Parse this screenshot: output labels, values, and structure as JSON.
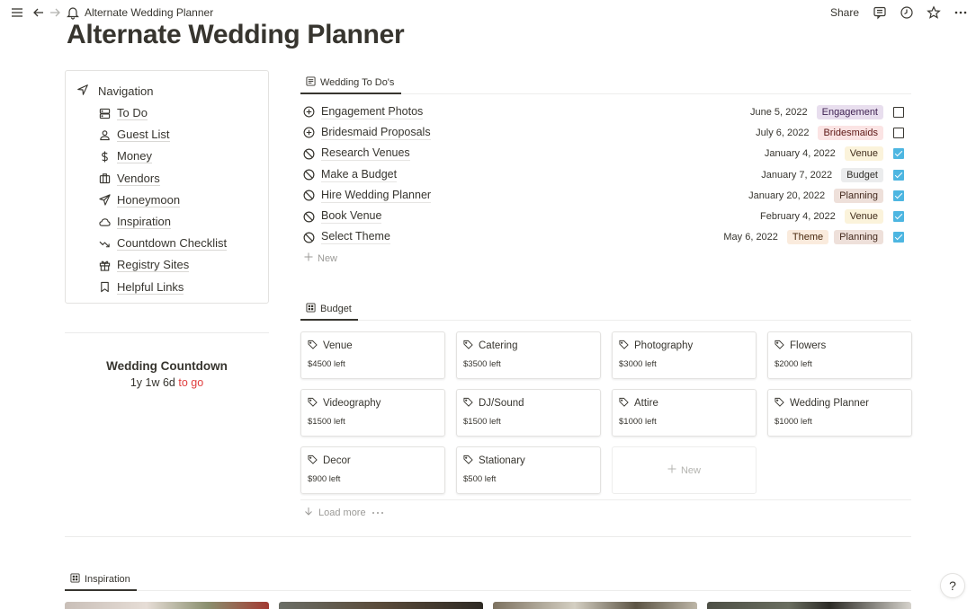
{
  "topbar": {
    "breadcrumb": "Alternate Wedding Planner",
    "share_label": "Share"
  },
  "page": {
    "title": "Alternate Wedding Planner"
  },
  "navigation": {
    "heading": "Navigation",
    "items": [
      {
        "label": "To Do",
        "icon": "database-icon"
      },
      {
        "label": "Guest List",
        "icon": "person-icon"
      },
      {
        "label": "Money",
        "icon": "dollar-icon"
      },
      {
        "label": "Vendors",
        "icon": "briefcase-icon"
      },
      {
        "label": "Honeymoon",
        "icon": "paper-plane-icon"
      },
      {
        "label": "Inspiration",
        "icon": "cloud-icon"
      },
      {
        "label": "Countdown Checklist",
        "icon": "trend-down-icon"
      },
      {
        "label": "Registry Sites",
        "icon": "gift-icon"
      },
      {
        "label": "Helpful Links",
        "icon": "bookmark-icon"
      }
    ]
  },
  "countdown": {
    "title": "Wedding Countdown",
    "value": "1y 1w 6d",
    "suffix": "to go"
  },
  "todos": {
    "tab_label": "Wedding To Do's",
    "new_label": "New",
    "rows": [
      {
        "name": "Engagement Photos",
        "status": "plus",
        "date": "June 5, 2022",
        "tags": [
          "Engagement"
        ],
        "done": false
      },
      {
        "name": "Bridesmaid Proposals",
        "status": "plus",
        "date": "July 6, 2022",
        "tags": [
          "Bridesmaids"
        ],
        "done": false
      },
      {
        "name": "Research Venues",
        "status": "blocked",
        "date": "January 4, 2022",
        "tags": [
          "Venue"
        ],
        "done": true
      },
      {
        "name": "Make a Budget",
        "status": "blocked",
        "date": "January 7, 2022",
        "tags": [
          "Budget"
        ],
        "done": true
      },
      {
        "name": "Hire Wedding Planner",
        "status": "blocked",
        "date": "January 20, 2022",
        "tags": [
          "Planning"
        ],
        "done": true
      },
      {
        "name": "Book Venue",
        "status": "blocked",
        "date": "February 4, 2022",
        "tags": [
          "Venue"
        ],
        "done": true
      },
      {
        "name": "Select Theme",
        "status": "blocked",
        "date": "May 6, 2022",
        "tags": [
          "Theme",
          "Planning"
        ],
        "done": true
      }
    ]
  },
  "tag_colors": {
    "Engagement": {
      "bg": "#e8deee",
      "fg": "#412454"
    },
    "Bridesmaids": {
      "bg": "#fbe4e4",
      "fg": "#5d1715"
    },
    "Venue": {
      "bg": "#fbf3db",
      "fg": "#402c1b"
    },
    "Budget": {
      "bg": "#ebeced",
      "fg": "#32302c"
    },
    "Planning": {
      "bg": "#eee0da",
      "fg": "#442a1e"
    },
    "Theme": {
      "bg": "#faebdd",
      "fg": "#49290e"
    }
  },
  "budget": {
    "tab_label": "Budget",
    "new_label": "New",
    "load_more_label": "Load more",
    "cards": [
      {
        "name": "Venue",
        "left": "$4500 left"
      },
      {
        "name": "Catering",
        "left": "$3500 left"
      },
      {
        "name": "Photography",
        "left": "$3000 left"
      },
      {
        "name": "Flowers",
        "left": "$2000 left"
      },
      {
        "name": "Videography",
        "left": "$1500 left"
      },
      {
        "name": "DJ/Sound",
        "left": "$1500 left"
      },
      {
        "name": "Attire",
        "left": "$1000 left"
      },
      {
        "name": "Wedding Planner",
        "left": "$1000 left"
      },
      {
        "name": "Decor",
        "left": "$900 left"
      },
      {
        "name": "Stationary",
        "left": "$500 left"
      }
    ]
  },
  "inspiration": {
    "tab_label": "Inspiration"
  },
  "help": {
    "label": "?"
  }
}
